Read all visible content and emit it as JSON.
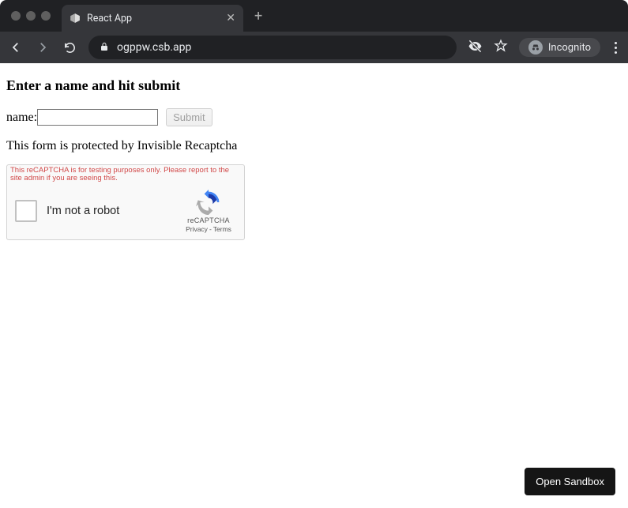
{
  "browser": {
    "tab_title": "React App",
    "address": "ogppw.csb.app",
    "incognito_label": "Incognito"
  },
  "page": {
    "heading": "Enter a name and hit submit",
    "name_label": "name:",
    "name_value": "",
    "submit_label": "Submit",
    "note": "This form is protected by Invisible Recaptcha"
  },
  "recaptcha": {
    "warning": "This reCAPTCHA is for testing purposes only. Please report to the site admin if you are seeing this.",
    "text": "I'm not a robot",
    "brand": "reCAPTCHA",
    "privacy": "Privacy",
    "terms": "Terms"
  },
  "buttons": {
    "open_sandbox": "Open Sandbox"
  }
}
